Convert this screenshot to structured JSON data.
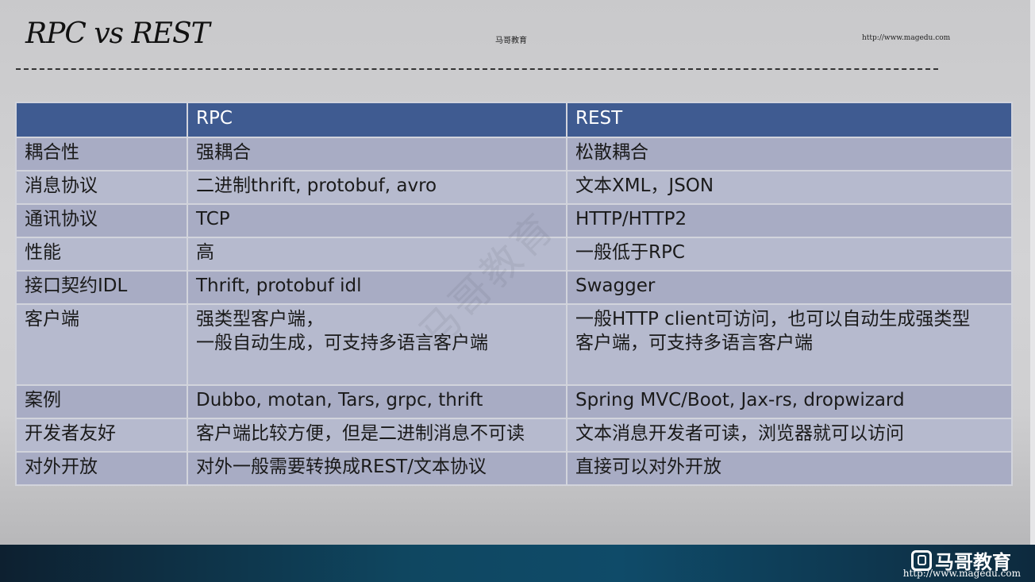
{
  "header": {
    "title": "RPC vs REST",
    "brand": "马哥教育",
    "url": "http://www.magedu.com"
  },
  "table": {
    "columns": [
      "",
      "RPC",
      "REST"
    ],
    "rows": [
      [
        "耦合性",
        "强耦合",
        "松散耦合"
      ],
      [
        "消息协议",
        "二进制thrift, protobuf, avro",
        "文本XML，JSON"
      ],
      [
        "通讯协议",
        "TCP",
        "HTTP/HTTP2"
      ],
      [
        "性能",
        "高",
        "一般低于RPC"
      ],
      [
        "接口契约IDL",
        "Thrift, protobuf idl",
        "Swagger"
      ],
      [
        "客户端",
        "强类型客户端，\n一般自动生成，可支持多语言客户端",
        "一般HTTP client可访问，也可以自动生成强类型\n客户端，可支持多语言客户端"
      ],
      [
        "案例",
        "Dubbo, motan, Tars, grpc, thrift",
        "Spring MVC/Boot, Jax-rs, dropwizard"
      ],
      [
        "开发者友好",
        "客户端比较方便，但是二进制消息不可读",
        "文本消息开发者可读，浏览器就可以访问"
      ],
      [
        "对外开放",
        "对外一般需要转换成REST/文本协议",
        "直接可以对外开放"
      ]
    ]
  },
  "watermark": "马哥教育",
  "footer": {
    "brand": "马哥教育",
    "url": "http://www.magedu.com"
  },
  "colors": {
    "header_row": "#3f5b91",
    "row_a": "#a8acc4",
    "row_b": "#b6bace",
    "footer_bar": "#0f4761"
  }
}
